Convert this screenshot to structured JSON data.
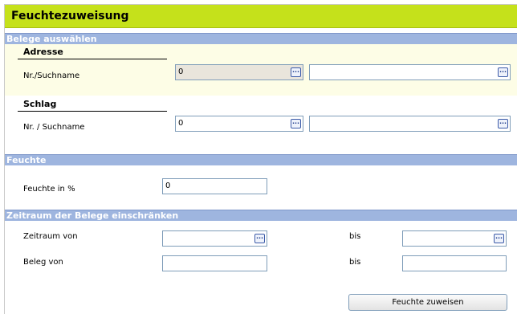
{
  "title": "Feuchtezuweisung",
  "sections": {
    "belege": "Belege auswählen",
    "feuchte": "Feuchte",
    "zeitraum": "Zeitraum der Belege einschränken"
  },
  "adresse": {
    "heading": "Adresse",
    "label": "Nr./Suchname",
    "nr_value": "0",
    "name_value": ""
  },
  "schlag": {
    "heading": "Schlag",
    "label": "Nr. / Suchname",
    "nr_value": "0",
    "name_value": ""
  },
  "feuchte": {
    "label": "Feuchte in %",
    "value": "0"
  },
  "zeitraum": {
    "von_label": "Zeitraum von",
    "bis_label": "bis",
    "von_value": "",
    "bis_value": ""
  },
  "beleg": {
    "von_label": "Beleg von",
    "bis_label": "bis",
    "von_value": "",
    "bis_value": ""
  },
  "lookup_button_label": "...",
  "submit_label": "Feuchte zuweisen",
  "colors": {
    "title_bar": "#c5e11b",
    "section_bar": "#9eb5df",
    "panel": "#fdfde6"
  }
}
